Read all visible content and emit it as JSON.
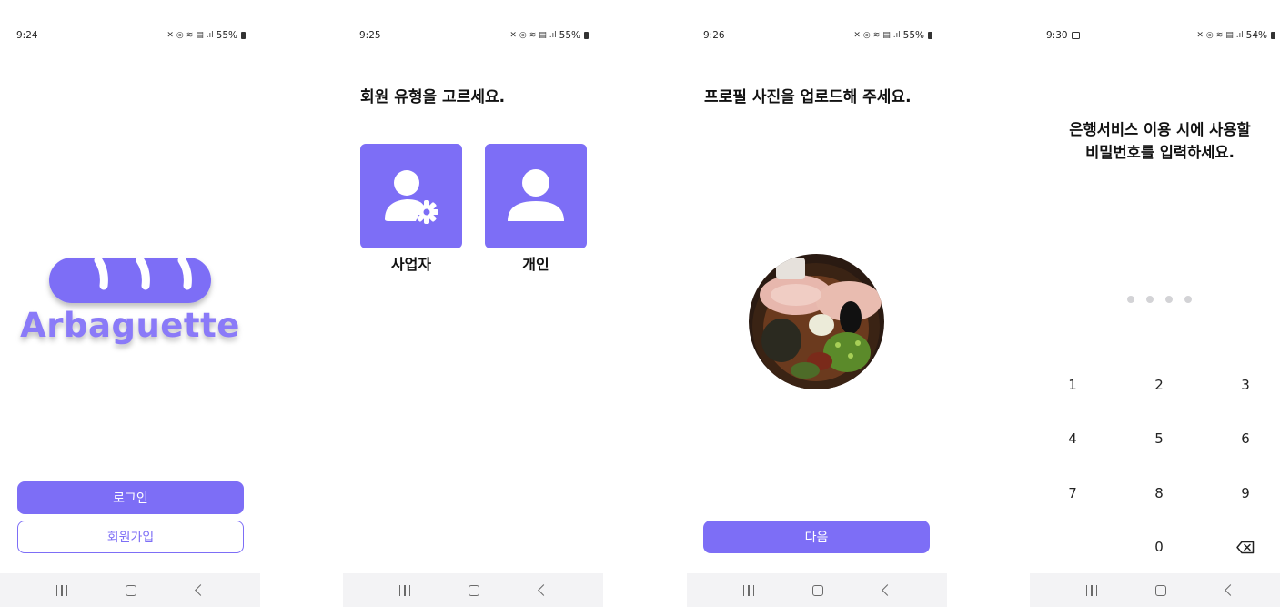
{
  "screens": [
    {
      "status": {
        "time": "9:24",
        "battery": "55%"
      },
      "logo_text": "Arbaguette",
      "login_label": "로그인",
      "signup_label": "회원가입"
    },
    {
      "status": {
        "time": "9:25",
        "battery": "55%"
      },
      "title": "회원 유형을 고르세요.",
      "options": [
        {
          "label": "사업자",
          "icon": "business-user-gear-icon"
        },
        {
          "label": "개인",
          "icon": "person-icon"
        }
      ]
    },
    {
      "status": {
        "time": "9:26",
        "battery": "55%"
      },
      "title": "프로필 사진을 업로드해 주세요.",
      "next_label": "다음"
    },
    {
      "status": {
        "time": "9:30",
        "battery": "54%"
      },
      "title_line1": "은행서비스 이용 시에 사용할",
      "title_line2": "비밀번호를 입력하세요.",
      "pin_length": 4,
      "keys": [
        "1",
        "2",
        "3",
        "4",
        "5",
        "6",
        "7",
        "8",
        "9",
        "0"
      ]
    }
  ],
  "colors": {
    "accent": "#7d6ef6",
    "logo": "#8a7af8",
    "navbar": "#f3f3f5",
    "pin_dot": "#d3d3d6"
  }
}
